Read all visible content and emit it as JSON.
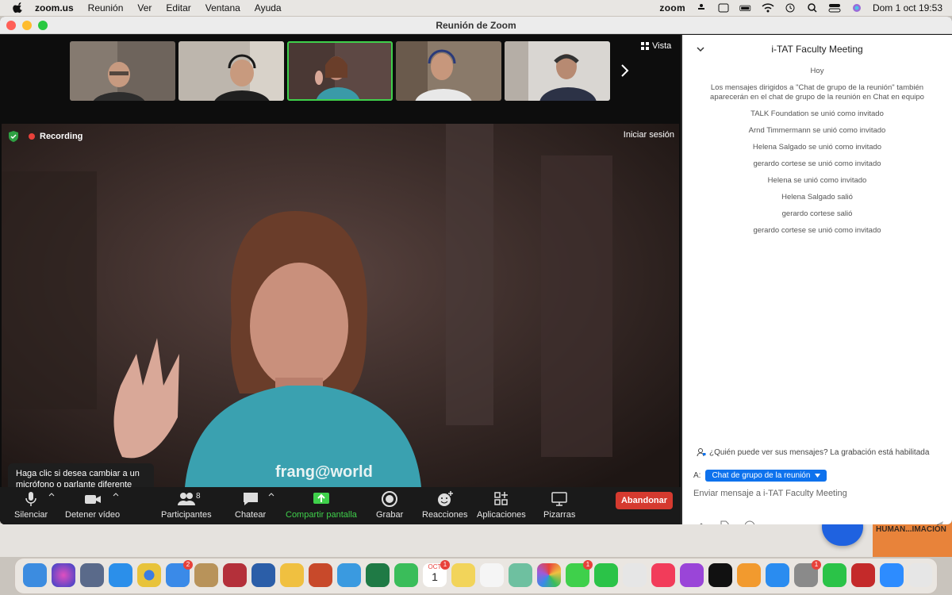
{
  "menubar": {
    "app_name": "zoom.us",
    "items": [
      "Reunión",
      "Ver",
      "Editar",
      "Ventana",
      "Ayuda"
    ],
    "status_app": "zoom",
    "datetime": "Dom 1 oct 19:53"
  },
  "window": {
    "title": "Reunión de Zoom"
  },
  "video": {
    "view_label": "Vista",
    "recording_label": "Recording",
    "signin_label": "Iniciar sesión",
    "shirt_text": "frang@world",
    "tooltip": "Haga clic si desea cambiar a un micrófono o parlante diferente"
  },
  "toolbar": {
    "mute": "Silenciar",
    "stop_video": "Detener vídeo",
    "participants": "Participantes",
    "participants_count": "8",
    "chat": "Chatear",
    "share": "Compartir pantalla",
    "record": "Grabar",
    "reactions": "Reacciones",
    "apps": "Aplicaciones",
    "whiteboards": "Pizarras",
    "leave": "Abandonar"
  },
  "chat": {
    "title": "i-TAT Faculty Meeting",
    "messages": [
      "Hoy",
      "Los mensajes dirigidos a \"Chat de grupo de la reunión\" también aparecerán en el chat de grupo de la reunión en Chat en equipo",
      "TALK Foundation se unió como invitado",
      "Arnd Timmermann se unió como invitado",
      "Helena Salgado se unió como invitado",
      "gerardo cortese se unió como invitado",
      "Helena se unió como invitado",
      "Helena Salgado salió",
      "gerardo cortese salió",
      "gerardo cortese se unió como invitado"
    ],
    "notice": "¿Quién puede ver sus mensajes? La grabación está habilitada",
    "to_label": "A:",
    "recipient": "Chat de grupo de la reunión",
    "input_placeholder": "Enviar mensaje a i-TAT Faculty Meeting"
  },
  "desktop": {
    "window_label": "HUMAN...IMACIÓN"
  },
  "dock": {
    "calendar_month": "OCT",
    "calendar_day": "1",
    "badges": {
      "mail": "2",
      "calendar": "1",
      "messages": "1",
      "settings": "1"
    }
  }
}
